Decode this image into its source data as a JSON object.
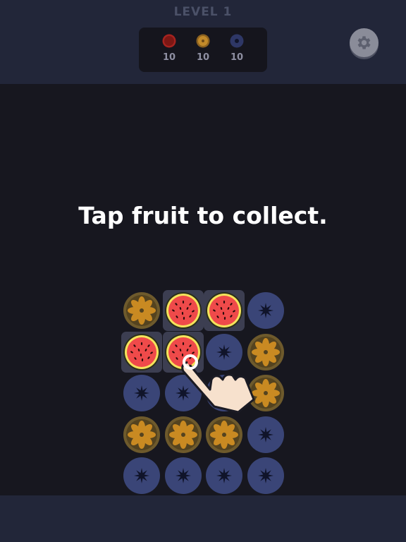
{
  "header": {
    "level_title": "LEVEL 1"
  },
  "goals": [
    {
      "fruit": "watermelon",
      "icon": "watermelon-icon",
      "count": "10"
    },
    {
      "fruit": "orange",
      "icon": "orange-icon",
      "count": "10"
    },
    {
      "fruit": "blueberry",
      "icon": "blueberry-icon",
      "count": "10"
    }
  ],
  "settings": {
    "icon": "gear-icon"
  },
  "tutorial": {
    "text": "Tap fruit to collect."
  },
  "board": {
    "rows": 5,
    "cols": 4,
    "tiles": [
      [
        "orange",
        "watermelon",
        "watermelon",
        "blueberry"
      ],
      [
        "watermelon",
        "watermelon",
        "blueberry",
        "orange"
      ],
      [
        "blueberry",
        "blueberry",
        "blueberry",
        "orange"
      ],
      [
        "orange",
        "orange",
        "orange",
        "blueberry"
      ],
      [
        "blueberry",
        "blueberry",
        "blueberry",
        "blueberry"
      ]
    ],
    "highlighted": [
      [
        0,
        1
      ],
      [
        0,
        2
      ],
      [
        1,
        0
      ],
      [
        1,
        1
      ]
    ]
  },
  "hint": {
    "icon": "pointing-hand-icon"
  },
  "colors": {
    "watermelon_flesh": "#ef4a4a",
    "watermelon_rind": "#f4e35c",
    "orange": "#c98a22",
    "orange_dark": "#6e5a2c",
    "blueberry": "#3a4577",
    "blueberry_star": "#10142a",
    "highlight": "#3c3e51"
  }
}
